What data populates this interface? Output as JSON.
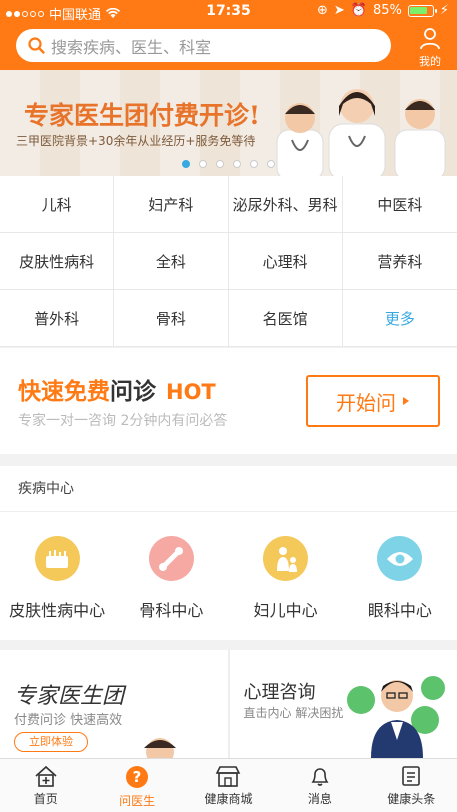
{
  "status_bar": {
    "carrier": "中国联通",
    "time": "17:35",
    "battery": "85%",
    "battery_level": 0.85
  },
  "header": {
    "search_placeholder": "搜索疾病、医生、科室",
    "me_label": "我的"
  },
  "banner": {
    "title": "专家医生团付费开诊!",
    "subtitle": "三甲医院背景+30余年从业经历+服务免等待",
    "active_page": 0,
    "page_count": 6
  },
  "departments": [
    {
      "label": "儿科"
    },
    {
      "label": "妇产科"
    },
    {
      "label": "泌尿外科、男科"
    },
    {
      "label": "中医科"
    },
    {
      "label": "皮肤性病科"
    },
    {
      "label": "全科"
    },
    {
      "label": "心理科"
    },
    {
      "label": "营养科"
    },
    {
      "label": "普外科"
    },
    {
      "label": "骨科"
    },
    {
      "label": "名医馆"
    },
    {
      "label": "更多"
    }
  ],
  "quick": {
    "title_a": "快速免费",
    "title_b": "问诊",
    "hot": "HOT",
    "subtitle": "专家一对一咨询 2分钟内有问必答",
    "button": "开始问"
  },
  "disease_center": {
    "heading": "疾病中心",
    "items": [
      {
        "label": "皮肤性病中心",
        "icon": "skin-icon",
        "color": "#f5c85a"
      },
      {
        "label": "骨科中心",
        "icon": "bone-icon",
        "color": "#f6a9a2"
      },
      {
        "label": "妇儿中心",
        "icon": "mother-child-icon",
        "color": "#f5c85a"
      },
      {
        "label": "眼科中心",
        "icon": "eye-icon",
        "color": "#7fd3e6"
      }
    ]
  },
  "promos": {
    "expert": {
      "title": "专家医生团",
      "subtitle": "付费问诊 快速高效",
      "button": "立即体验"
    },
    "psych": {
      "title": "心理咨询",
      "subtitle": "直击内心 解决困扰"
    }
  },
  "tabs": [
    {
      "label": "首页",
      "icon": "home-icon"
    },
    {
      "label": "问医生",
      "icon": "question-icon"
    },
    {
      "label": "健康商城",
      "icon": "shop-icon"
    },
    {
      "label": "消息",
      "icon": "bell-icon"
    },
    {
      "label": "健康头条",
      "icon": "news-icon"
    }
  ],
  "colors": {
    "accent": "#ff7a14",
    "link": "#36a9e1"
  }
}
